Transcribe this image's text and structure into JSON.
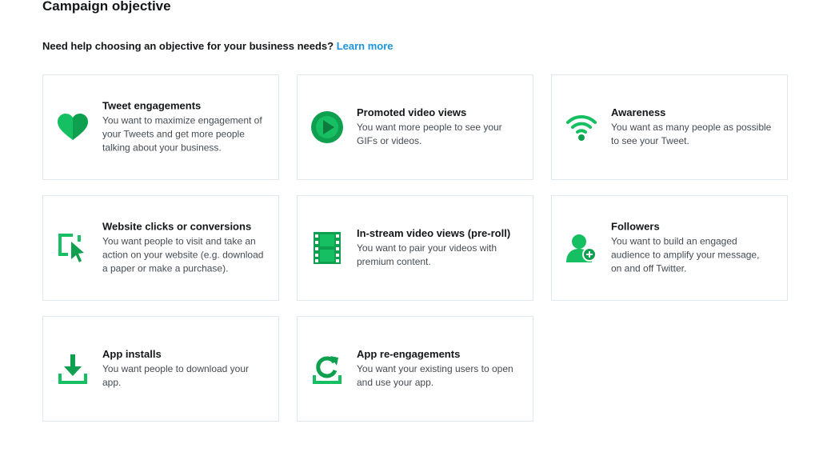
{
  "page": {
    "title": "Campaign objective",
    "help_text": "Need help choosing an objective for your business needs?",
    "learn_more": "Learn more"
  },
  "colors": {
    "accent_green": "#17bf63",
    "dark_green": "#0e9f4f",
    "link_blue": "#1b95e0"
  },
  "objectives": [
    {
      "title": "Tweet engagements",
      "description": "You want to maximize engagement of your Tweets and get more people talking about your business.",
      "icon": "heart-icon"
    },
    {
      "title": "Promoted video views",
      "description": "You want more people to see your GIFs or videos.",
      "icon": "play-icon"
    },
    {
      "title": "Awareness",
      "description": "You want as many people as possible to see your Tweet.",
      "icon": "signal-icon"
    },
    {
      "title": "Website clicks or conversions",
      "description": "You want people to visit and take an action on your website (e.g. download a paper or make a purchase).",
      "icon": "cursor-click-icon"
    },
    {
      "title": "In-stream video views (pre-roll)",
      "description": "You want to pair your videos with premium content.",
      "icon": "film-icon"
    },
    {
      "title": "Followers",
      "description": "You want to build an engaged audience to amplify your message, on and off Twitter.",
      "icon": "add-follower-icon"
    },
    {
      "title": "App installs",
      "description": "You want people to download your app.",
      "icon": "download-icon"
    },
    {
      "title": "App re-engagements",
      "description": "You want your existing users to open and use your app.",
      "icon": "refresh-icon"
    }
  ]
}
